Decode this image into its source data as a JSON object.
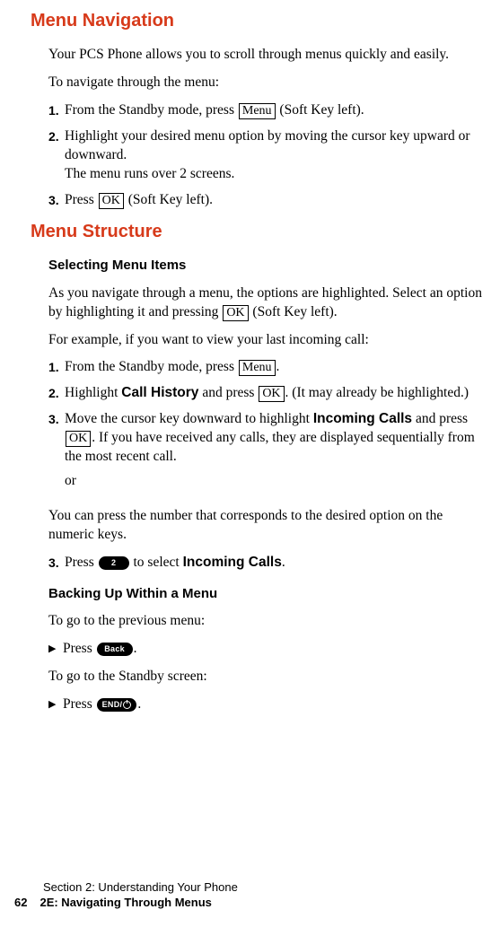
{
  "h1": "Menu Navigation",
  "intro1": "Your PCS Phone allows you to scroll through menus quickly and easily.",
  "intro2": "To navigate through the menu:",
  "nav_steps": {
    "s1_pre": "From the Standby mode, press ",
    "s1_key": "Menu",
    "s1_post": " (Soft Key left).",
    "s2_a": "Highlight your desired menu option by moving the cursor key upward or downward.",
    "s2_b": "The menu runs over 2 screens.",
    "s3_pre": "Press ",
    "s3_key": "OK",
    "s3_post": " (Soft Key left)."
  },
  "h2": "Menu Structure",
  "sub1": "Selecting Menu Items",
  "sel_p1_a": "As you navigate through a menu, the options are highlighted. Select an option by highlighting it and pressing ",
  "sel_p1_key": "OK",
  "sel_p1_b": " (Soft Key left).",
  "sel_p2": "For example, if you want to view your last incoming call:",
  "sel_steps": {
    "s1_pre": "From the Standby mode, press ",
    "s1_key": "Menu",
    "s1_post": ".",
    "s2_pre": "Highlight ",
    "s2_bold": "Call History",
    "s2_mid": " and press ",
    "s2_key": "OK",
    "s2_post": ". (It may already be highlighted.)",
    "s3_a": "Move the cursor key downward to highlight ",
    "s3_bold": "Incoming Calls",
    "s3_b": " and press ",
    "s3_key": "OK",
    "s3_c": ". If you have received any calls, they are displayed sequentially from the most recent call.",
    "or": "or"
  },
  "sel_alt": "You can press the number that corresponds to the desired option on the numeric keys.",
  "sel_step3b_pre": "Press ",
  "sel_step3b_key": "2",
  "sel_step3b_mid": " to select ",
  "sel_step3b_bold": "Incoming Calls",
  "sel_step3b_post": ".",
  "sub2": "Backing Up Within a Menu",
  "back_p1": "To go to the previous menu:",
  "back_b1_pre": "Press ",
  "back_b1_key": "Back",
  "back_b1_post": ".",
  "back_p2": "To go to the Standby screen:",
  "back_b2_pre": "Press ",
  "back_b2_key": "END/",
  "back_b2_post": ".",
  "footer": {
    "line1": "Section 2: Understanding Your Phone",
    "page": "62",
    "line2": "2E: Navigating Through Menus"
  },
  "nums": {
    "n1": "1.",
    "n2": "2.",
    "n3": "3."
  },
  "tri": "▶"
}
